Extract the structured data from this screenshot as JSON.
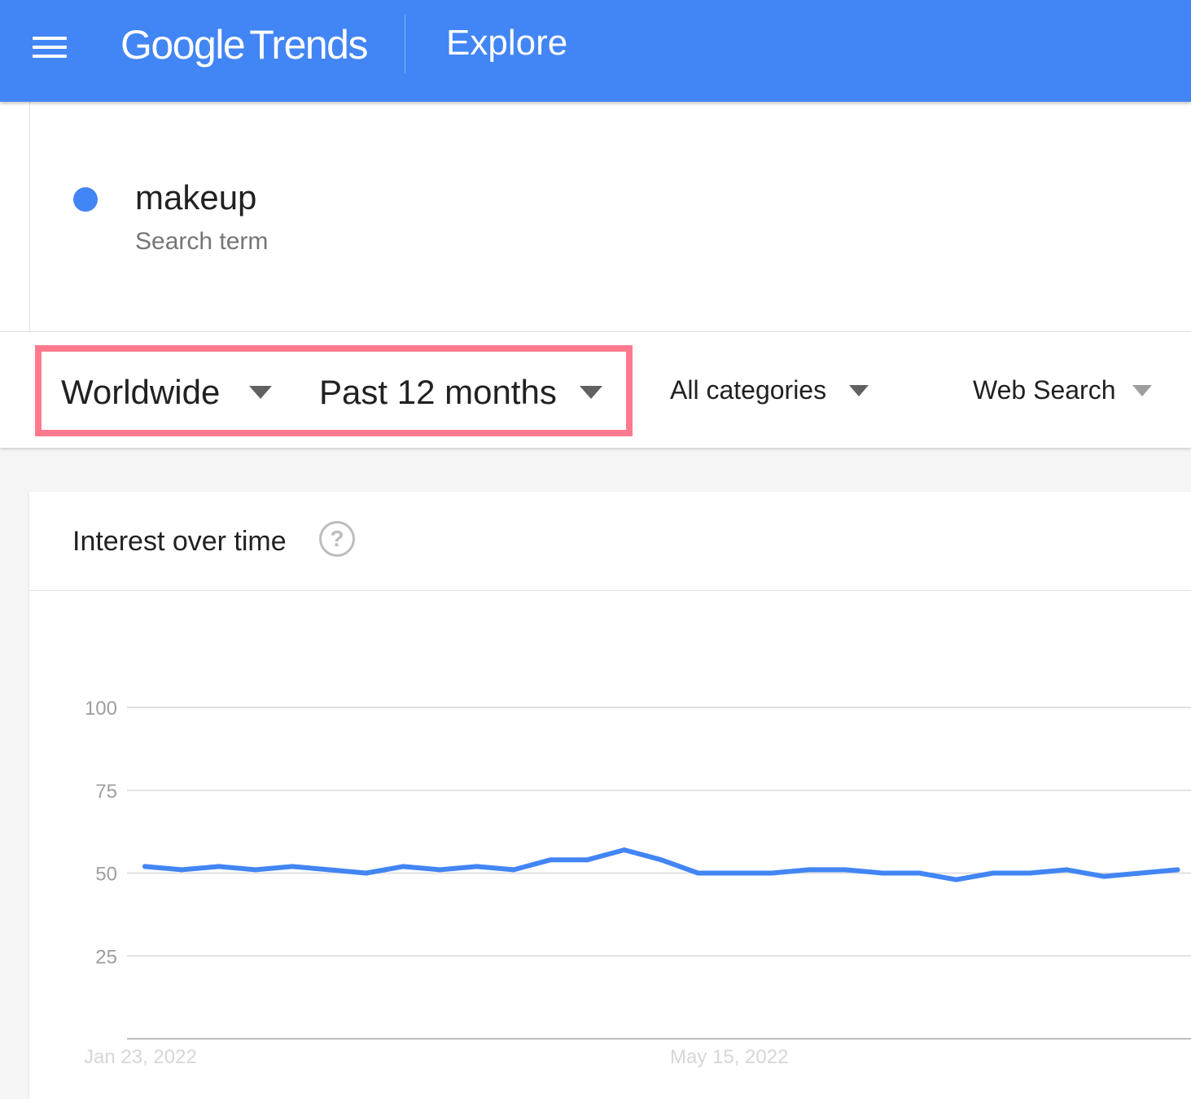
{
  "header": {
    "logo_google": "Google",
    "logo_trends": "Trends",
    "title": "Explore"
  },
  "term": {
    "name": "makeup",
    "type": "Search term",
    "color": "#4285f4"
  },
  "filters": {
    "region": "Worldwide",
    "time_range": "Past 12 months",
    "category": "All categories",
    "property": "Web Search",
    "highlight_color": "#ff7a8e"
  },
  "card": {
    "title": "Interest over time",
    "help_glyph": "?"
  },
  "chart_data": {
    "type": "line",
    "title": "Interest over time",
    "ylim": [
      0,
      100
    ],
    "yticks": [
      25,
      50,
      75,
      100
    ],
    "x_labels": [
      "Jan 23, 2022",
      "May 15, 2022"
    ],
    "series": [
      {
        "name": "makeup",
        "color": "#4285f4",
        "values": [
          52,
          51,
          52,
          51,
          52,
          51,
          50,
          52,
          51,
          52,
          51,
          54,
          54,
          57,
          54,
          50,
          50,
          50,
          51,
          51,
          50,
          50,
          48,
          50,
          50,
          51,
          49,
          50,
          51
        ]
      }
    ]
  }
}
